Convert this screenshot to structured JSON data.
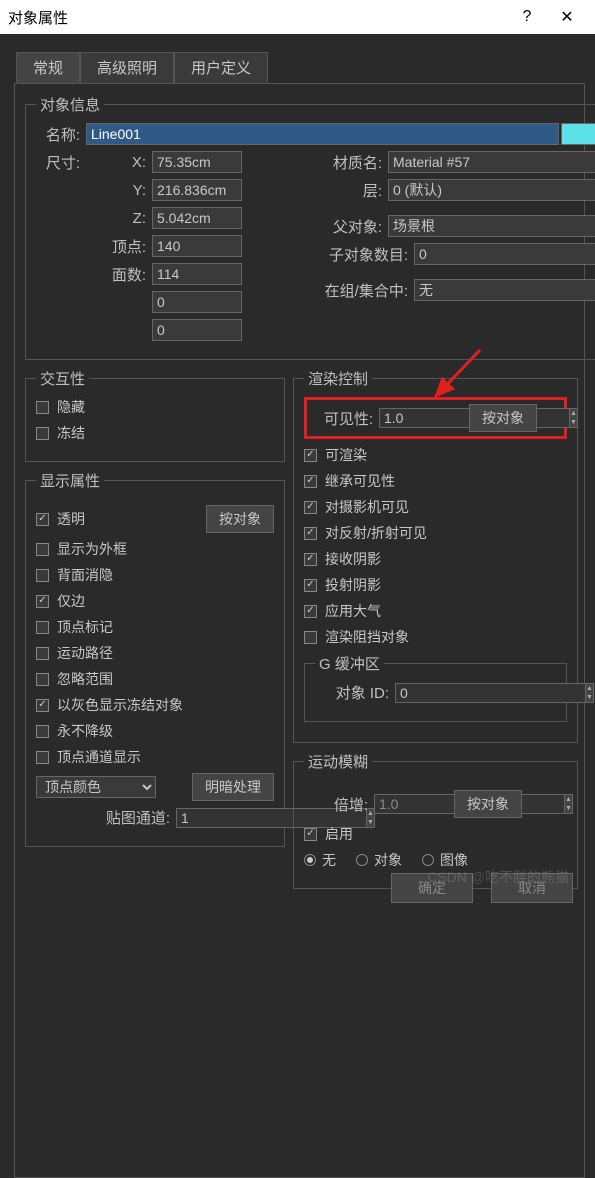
{
  "window": {
    "title": "对象属性",
    "help": "?",
    "close": "✕"
  },
  "tabs": {
    "general": "常规",
    "advanced": "高级照明",
    "user": "用户定义"
  },
  "info": {
    "legend": "对象信息",
    "name_lbl": "名称:",
    "name": "Line001",
    "size_lbl": "尺寸:",
    "x_lbl": "X:",
    "x": "75.35cm",
    "y_lbl": "Y:",
    "y": "216.836cm",
    "z_lbl": "Z:",
    "z": "5.042cm",
    "verts_lbl": "顶点:",
    "verts": "140",
    "faces_lbl": "面数:",
    "faces": "114",
    "extra1": "0",
    "extra2": "0",
    "mat_lbl": "材质名:",
    "mat": "Material #57",
    "layer_lbl": "层:",
    "layer": "0 (默认)",
    "parent_lbl": "父对象:",
    "parent": "场景根",
    "sub_lbl": "子对象数目:",
    "sub": "0",
    "group_lbl": "在组/集合中:",
    "group": "无"
  },
  "inter": {
    "legend": "交互性",
    "hide": "隐藏",
    "freeze": "冻结"
  },
  "disp": {
    "legend": "显示属性",
    "transparent": "透明",
    "byobj": "按对象",
    "wireframe": "显示为外框",
    "backface": "背面消隐",
    "edgesonly": "仅边",
    "vertticks": "顶点标记",
    "path": "运动路径",
    "ignore": "忽略范围",
    "frozgray": "以灰色显示冻结对象",
    "nodeg": "永不降级",
    "vertchan": "顶点通道显示",
    "vertcolor": "顶点颜色",
    "shaded": "明暗处理",
    "mapchan_lbl": "贴图通道:",
    "mapchan": "1"
  },
  "rend": {
    "legend": "渲染控制",
    "vis_lbl": "可见性:",
    "vis": "1.0",
    "byobj": "按对象",
    "renderable": "可渲染",
    "inheritvis": "继承可见性",
    "camvis": "对摄影机可见",
    "reflvis": "对反射/折射可见",
    "recvshad": "接收阴影",
    "castshad": "投射阴影",
    "atmos": "应用大气",
    "occluder": "渲染阻挡对象"
  },
  "gbuf": {
    "legend": "G 缓冲区",
    "objid_lbl": "对象 ID:",
    "objid": "0"
  },
  "mblur": {
    "legend": "运动模糊",
    "mult_lbl": "倍增:",
    "mult": "1.0",
    "byobj": "按对象",
    "enable": "启用",
    "none": "无",
    "obj": "对象",
    "img": "图像"
  },
  "buttons": {
    "ok": "确定",
    "cancel": "取消"
  },
  "watermark": "CSDN @吃不胖的熊猫"
}
